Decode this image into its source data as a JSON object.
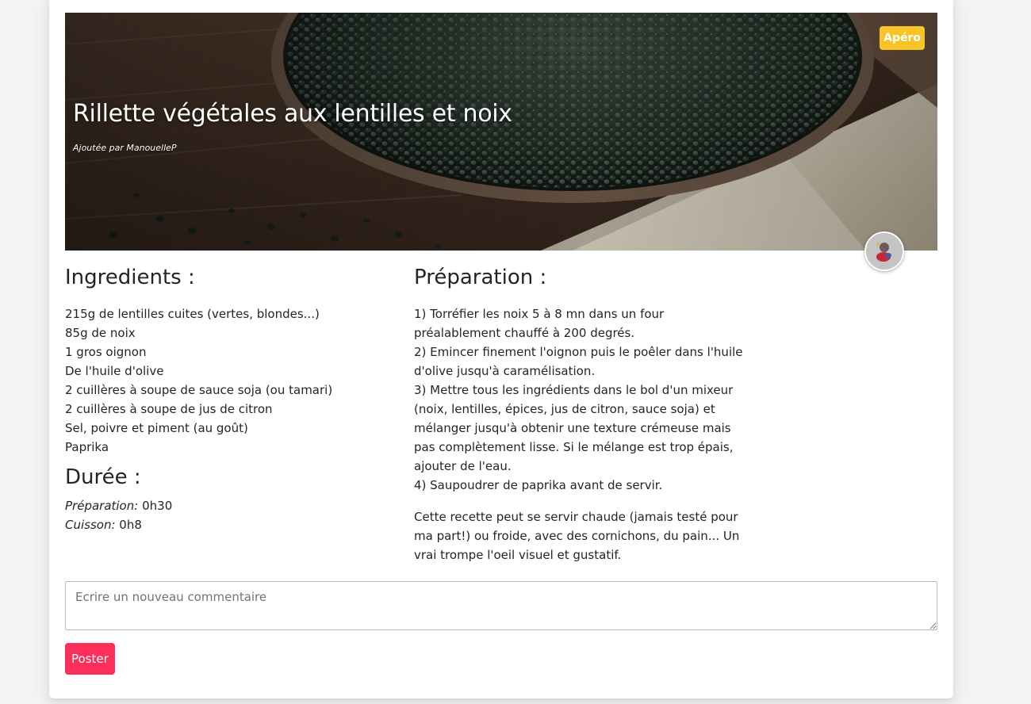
{
  "recipe": {
    "title": "Rillette végétales aux lentilles et noix",
    "author": "Ajoutée par ManouelleP",
    "category_badge": "Apéro",
    "ingredients_title": "Ingredients :",
    "ingredients": [
      "215g de lentilles cuites (vertes, blondes...)",
      "85g de noix",
      "1 gros oignon",
      "De l'huile d'olive",
      "2 cuillères à soupe de sauce soja (ou tamari)",
      "2 cuillères à soupe de jus de citron",
      "Sel, poivre et piment (au goût)",
      "Paprika"
    ],
    "duration_title": "Durée :",
    "duration": {
      "prep_label": "Préparation:",
      "prep_value": "0h30",
      "cook_label": "Cuisson:",
      "cook_value": "0h8"
    },
    "preparation_title": "Préparation :",
    "preparation_lines": [
      "1) Torréfier les noix 5 à 8 mn dans un four",
      "préalablement chauffé à 200 degrés.",
      "2) Emincer finement l'oignon puis le poêler dans l'huile",
      "d'olive jusqu'à caramélisation.",
      "3) Mettre tous les ingrédients dans le bol d'un mixeur",
      "(noix, lentilles, épices, jus de citron, sauce soja) et",
      "mélanger jusqu'à obtenir une texture crémeuse mais",
      "pas complètement lisse. Si le mélange est trop épais,",
      "ajouter de l'eau.",
      "4) Saupoudrer de paprika avant de servir."
    ],
    "note_lines": [
      "Cette recette peut se servir chaude (jamais testé pour",
      "ma part!) ou froide, avec des cornichons, du pain... Un",
      "vrai trompe l'oeil visuel et gustatif."
    ]
  },
  "comment": {
    "placeholder": "Ecrire un nouveau commentaire",
    "value": "",
    "submit_label": "Poster"
  },
  "colors": {
    "badge": "#f7c325",
    "post_button": "#fc2e5a"
  },
  "icons": {
    "avatar": "user-avatar-image"
  }
}
